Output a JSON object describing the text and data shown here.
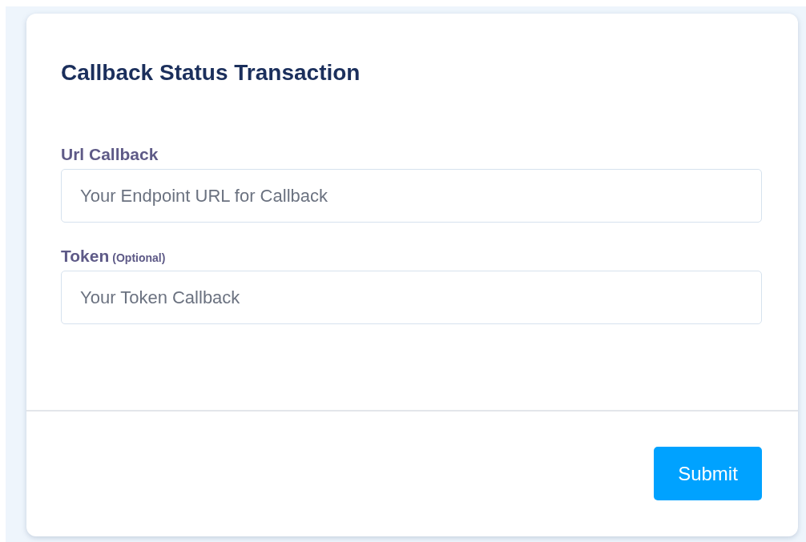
{
  "card": {
    "title": "Callback Status Transaction",
    "fields": [
      {
        "label": "Url Callback",
        "placeholder": "Your Endpoint URL for Callback"
      },
      {
        "label": "Token",
        "note": "(Optional)",
        "placeholder": "Your Token Callback"
      }
    ],
    "submit": "Submit"
  }
}
